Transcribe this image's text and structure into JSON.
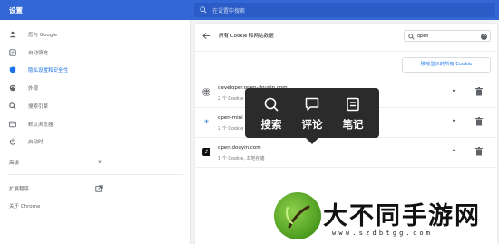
{
  "app": {
    "title": "设置"
  },
  "search": {
    "placeholder": "在设置中搜索"
  },
  "sidebar": {
    "items": [
      {
        "label": "您与 Google",
        "icon": "person-icon"
      },
      {
        "label": "自动填充",
        "icon": "autofill-icon"
      },
      {
        "label": "隐私设置和安全性",
        "icon": "shield-icon",
        "active": true
      },
      {
        "label": "外观",
        "icon": "palette-icon"
      },
      {
        "label": "搜索引擎",
        "icon": "search-icon"
      },
      {
        "label": "默认浏览器",
        "icon": "browser-icon"
      },
      {
        "label": "启动时",
        "icon": "power-icon"
      }
    ],
    "advanced": "高级",
    "extensions": "扩展程序",
    "about": "关于 Chrome"
  },
  "page": {
    "title": "所有 Cookie 和网站数据",
    "filter_value": "open",
    "remove_all_button": "移除显示的所有 Cookie"
  },
  "sites": [
    {
      "domain": "developer.open-douyin.com",
      "detail": "2 个 Cookie"
    },
    {
      "domain": "open-mini",
      "detail": "2 个 Cookie"
    },
    {
      "domain": "open.douyin.com",
      "detail": "1 个 Cookie, 本地存储"
    }
  ],
  "popup": {
    "search": "搜索",
    "comment": "评论",
    "note": "笔记"
  },
  "watermark": {
    "name": "大不同手游网",
    "url": "www.szdbtgg.com"
  },
  "colors": {
    "header": "#3367d6",
    "accent": "#1a73e8",
    "popup_bg": "#2b2b2b"
  }
}
